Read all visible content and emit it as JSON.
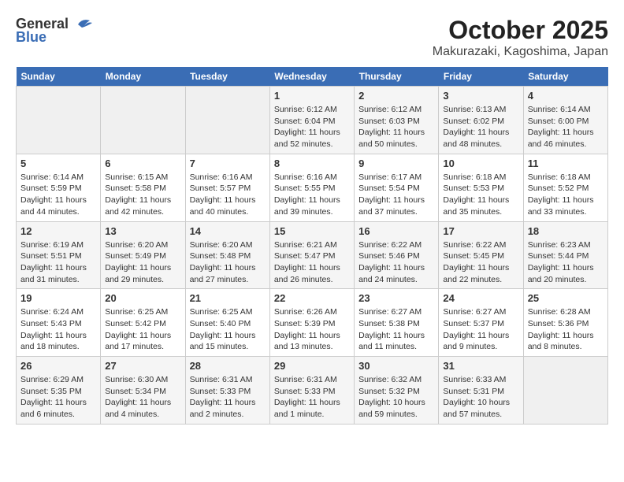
{
  "header": {
    "logo_general": "General",
    "logo_blue": "Blue",
    "month_title": "October 2025",
    "location": "Makurazaki, Kagoshima, Japan"
  },
  "weekdays": [
    "Sunday",
    "Monday",
    "Tuesday",
    "Wednesday",
    "Thursday",
    "Friday",
    "Saturday"
  ],
  "weeks": [
    [
      {
        "day": "",
        "info": ""
      },
      {
        "day": "",
        "info": ""
      },
      {
        "day": "",
        "info": ""
      },
      {
        "day": "1",
        "info": "Sunrise: 6:12 AM\nSunset: 6:04 PM\nDaylight: 11 hours\nand 52 minutes."
      },
      {
        "day": "2",
        "info": "Sunrise: 6:12 AM\nSunset: 6:03 PM\nDaylight: 11 hours\nand 50 minutes."
      },
      {
        "day": "3",
        "info": "Sunrise: 6:13 AM\nSunset: 6:02 PM\nDaylight: 11 hours\nand 48 minutes."
      },
      {
        "day": "4",
        "info": "Sunrise: 6:14 AM\nSunset: 6:00 PM\nDaylight: 11 hours\nand 46 minutes."
      }
    ],
    [
      {
        "day": "5",
        "info": "Sunrise: 6:14 AM\nSunset: 5:59 PM\nDaylight: 11 hours\nand 44 minutes."
      },
      {
        "day": "6",
        "info": "Sunrise: 6:15 AM\nSunset: 5:58 PM\nDaylight: 11 hours\nand 42 minutes."
      },
      {
        "day": "7",
        "info": "Sunrise: 6:16 AM\nSunset: 5:57 PM\nDaylight: 11 hours\nand 40 minutes."
      },
      {
        "day": "8",
        "info": "Sunrise: 6:16 AM\nSunset: 5:55 PM\nDaylight: 11 hours\nand 39 minutes."
      },
      {
        "day": "9",
        "info": "Sunrise: 6:17 AM\nSunset: 5:54 PM\nDaylight: 11 hours\nand 37 minutes."
      },
      {
        "day": "10",
        "info": "Sunrise: 6:18 AM\nSunset: 5:53 PM\nDaylight: 11 hours\nand 35 minutes."
      },
      {
        "day": "11",
        "info": "Sunrise: 6:18 AM\nSunset: 5:52 PM\nDaylight: 11 hours\nand 33 minutes."
      }
    ],
    [
      {
        "day": "12",
        "info": "Sunrise: 6:19 AM\nSunset: 5:51 PM\nDaylight: 11 hours\nand 31 minutes."
      },
      {
        "day": "13",
        "info": "Sunrise: 6:20 AM\nSunset: 5:49 PM\nDaylight: 11 hours\nand 29 minutes."
      },
      {
        "day": "14",
        "info": "Sunrise: 6:20 AM\nSunset: 5:48 PM\nDaylight: 11 hours\nand 27 minutes."
      },
      {
        "day": "15",
        "info": "Sunrise: 6:21 AM\nSunset: 5:47 PM\nDaylight: 11 hours\nand 26 minutes."
      },
      {
        "day": "16",
        "info": "Sunrise: 6:22 AM\nSunset: 5:46 PM\nDaylight: 11 hours\nand 24 minutes."
      },
      {
        "day": "17",
        "info": "Sunrise: 6:22 AM\nSunset: 5:45 PM\nDaylight: 11 hours\nand 22 minutes."
      },
      {
        "day": "18",
        "info": "Sunrise: 6:23 AM\nSunset: 5:44 PM\nDaylight: 11 hours\nand 20 minutes."
      }
    ],
    [
      {
        "day": "19",
        "info": "Sunrise: 6:24 AM\nSunset: 5:43 PM\nDaylight: 11 hours\nand 18 minutes."
      },
      {
        "day": "20",
        "info": "Sunrise: 6:25 AM\nSunset: 5:42 PM\nDaylight: 11 hours\nand 17 minutes."
      },
      {
        "day": "21",
        "info": "Sunrise: 6:25 AM\nSunset: 5:40 PM\nDaylight: 11 hours\nand 15 minutes."
      },
      {
        "day": "22",
        "info": "Sunrise: 6:26 AM\nSunset: 5:39 PM\nDaylight: 11 hours\nand 13 minutes."
      },
      {
        "day": "23",
        "info": "Sunrise: 6:27 AM\nSunset: 5:38 PM\nDaylight: 11 hours\nand 11 minutes."
      },
      {
        "day": "24",
        "info": "Sunrise: 6:27 AM\nSunset: 5:37 PM\nDaylight: 11 hours\nand 9 minutes."
      },
      {
        "day": "25",
        "info": "Sunrise: 6:28 AM\nSunset: 5:36 PM\nDaylight: 11 hours\nand 8 minutes."
      }
    ],
    [
      {
        "day": "26",
        "info": "Sunrise: 6:29 AM\nSunset: 5:35 PM\nDaylight: 11 hours\nand 6 minutes."
      },
      {
        "day": "27",
        "info": "Sunrise: 6:30 AM\nSunset: 5:34 PM\nDaylight: 11 hours\nand 4 minutes."
      },
      {
        "day": "28",
        "info": "Sunrise: 6:31 AM\nSunset: 5:33 PM\nDaylight: 11 hours\nand 2 minutes."
      },
      {
        "day": "29",
        "info": "Sunrise: 6:31 AM\nSunset: 5:33 PM\nDaylight: 11 hours\nand 1 minute."
      },
      {
        "day": "30",
        "info": "Sunrise: 6:32 AM\nSunset: 5:32 PM\nDaylight: 10 hours\nand 59 minutes."
      },
      {
        "day": "31",
        "info": "Sunrise: 6:33 AM\nSunset: 5:31 PM\nDaylight: 10 hours\nand 57 minutes."
      },
      {
        "day": "",
        "info": ""
      }
    ]
  ]
}
